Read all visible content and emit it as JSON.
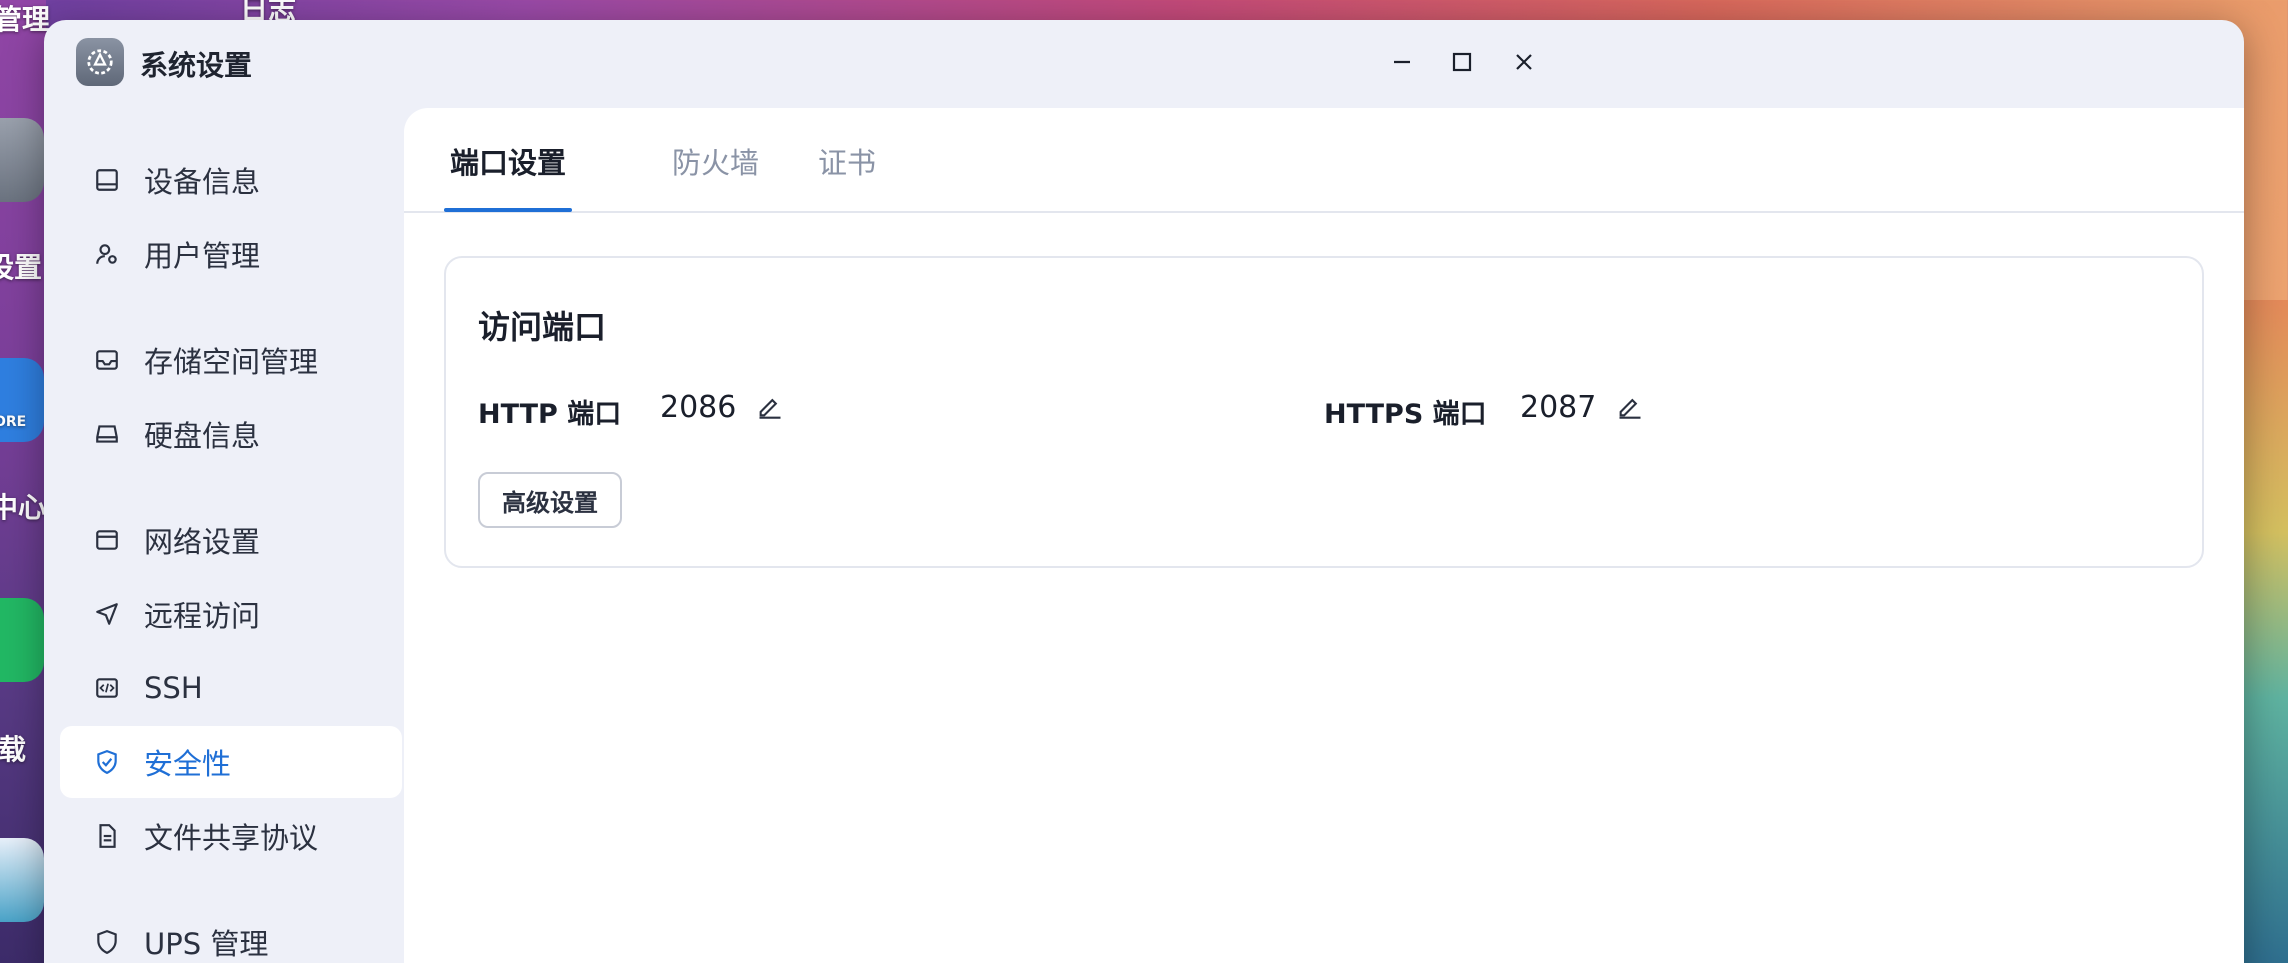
{
  "window": {
    "title": "系统设置",
    "controls": [
      "minimize-icon",
      "maximize-icon",
      "close-icon"
    ]
  },
  "desktop": {
    "labels": [
      "管理",
      "日志",
      "设置",
      "ORE",
      "中心",
      "载"
    ]
  },
  "sidebar": {
    "items": [
      {
        "label": "设备信息",
        "icon": "device-info-icon"
      },
      {
        "label": "用户管理",
        "icon": "user-icon"
      },
      {
        "label": "存储空间管理",
        "icon": "storage-icon"
      },
      {
        "label": "硬盘信息",
        "icon": "disk-icon"
      },
      {
        "label": "网络设置",
        "icon": "network-icon"
      },
      {
        "label": "远程访问",
        "icon": "remote-icon"
      },
      {
        "label": "SSH",
        "icon": "ssh-icon"
      },
      {
        "label": "安全性",
        "icon": "shield-check-icon",
        "active": true
      },
      {
        "label": "文件共享协议",
        "icon": "file-share-icon"
      },
      {
        "label": "UPS 管理",
        "icon": "shield-icon"
      }
    ]
  },
  "tabs": [
    {
      "label": "端口设置",
      "active": true
    },
    {
      "label": "防火墙"
    },
    {
      "label": "证书"
    }
  ],
  "card": {
    "title": "访问端口",
    "http_label": "HTTP 端口",
    "http_value": "2086",
    "https_label": "HTTPS 端口",
    "https_value": "2087",
    "advanced_button": "高级设置"
  },
  "colors": {
    "accent": "#1f6fd6",
    "window_bg": "#eef0f8",
    "content_bg": "#ffffff"
  }
}
